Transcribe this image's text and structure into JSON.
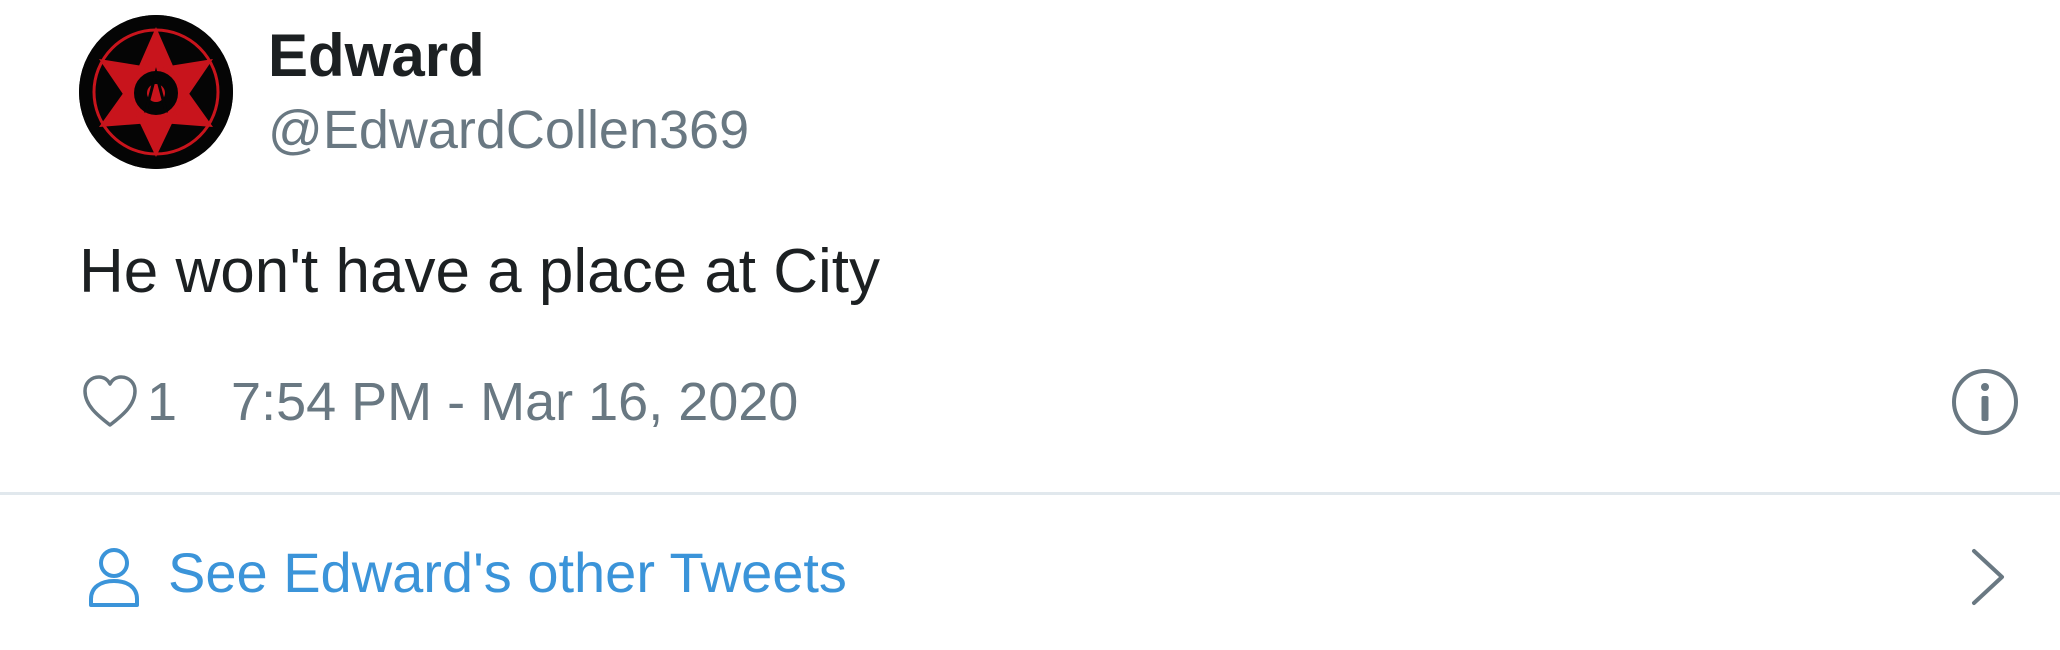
{
  "author": {
    "display_name": "Edward",
    "handle": "@EdwardCollen369",
    "avatar_icon": "sharingan-avatar-icon"
  },
  "tweet": {
    "text": "He won't have a place at City",
    "like_count": "1",
    "timestamp": "7:54 PM - Mar 16, 2020"
  },
  "footer": {
    "label": "See Edward's other Tweets",
    "icon": "person-icon"
  },
  "colors": {
    "text_primary": "#1c2022",
    "text_secondary": "#697882",
    "link": "#3b94d9",
    "divider": "#e1e8ed",
    "avatar_red": "#c8141c"
  }
}
